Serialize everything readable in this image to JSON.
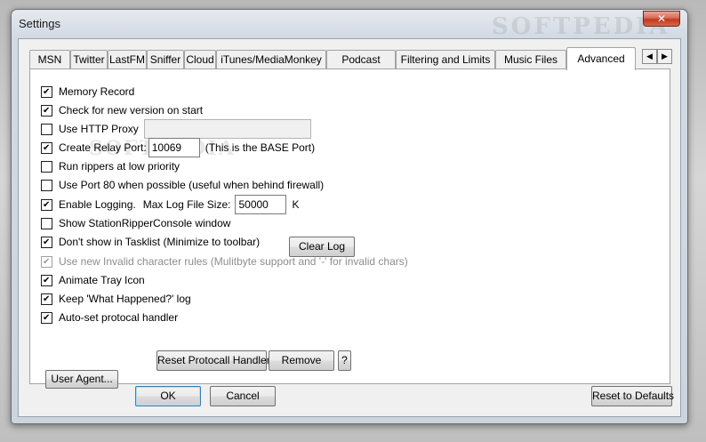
{
  "window": {
    "title": "Settings",
    "close_glyph": "✕"
  },
  "tabs": [
    {
      "label": "MSN"
    },
    {
      "label": "Twitter"
    },
    {
      "label": "LastFM"
    },
    {
      "label": "Sniffer"
    },
    {
      "label": "Cloud"
    },
    {
      "label": "iTunes/MediaMonkey"
    },
    {
      "label": "Podcast"
    },
    {
      "label": "Filtering and Limits"
    },
    {
      "label": "Music Files"
    },
    {
      "label": "Advanced",
      "active": true
    }
  ],
  "tab_scroll": {
    "left": "◀",
    "right": "▶"
  },
  "advanced": {
    "memory_record": {
      "label": "Memory Record",
      "checked": true
    },
    "check_version": {
      "label": "Check for new version on start",
      "checked": true
    },
    "http_proxy": {
      "label": "Use HTTP Proxy",
      "checked": false,
      "value": ""
    },
    "relay_port": {
      "label": "Create Relay Port:",
      "checked": true,
      "value": "10069",
      "note": "(This is the BASE Port)"
    },
    "low_priority": {
      "label": "Run rippers at low priority",
      "checked": false
    },
    "port80": {
      "label": "Use Port 80 when possible (useful when behind firewall)",
      "checked": false
    },
    "logging": {
      "label": "Enable Logging.",
      "checked": true,
      "max_label": "Max Log File Size:",
      "value": "50000",
      "unit": "K",
      "clear_button": "Clear Log"
    },
    "show_console": {
      "label": "Show StationRipperConsole window",
      "checked": false
    },
    "tasklist": {
      "label": "Don't show in Tasklist (Minimize to toolbar)",
      "checked": true
    },
    "invalid_chars": {
      "label": "Use new Invalid character rules (Mulitbyte support and '-' for invalid chars)",
      "checked": true,
      "disabled": true
    },
    "animate_tray": {
      "label": "Animate Tray Icon",
      "checked": true
    },
    "keep_log": {
      "label": "Keep 'What Happened?' log",
      "checked": true
    },
    "protocol": {
      "label": "Auto-set protocal handler",
      "checked": true,
      "reset_button": "Reset Protocall Handler",
      "remove_button": "Remove",
      "help_button": "?"
    },
    "user_agent_button": "User Agent..."
  },
  "footer": {
    "ok": "OK",
    "cancel": "Cancel",
    "reset": "Reset to Defaults"
  },
  "watermark": {
    "text": "SOFTPEDIA",
    "text2": "SOFTPEDIA"
  }
}
